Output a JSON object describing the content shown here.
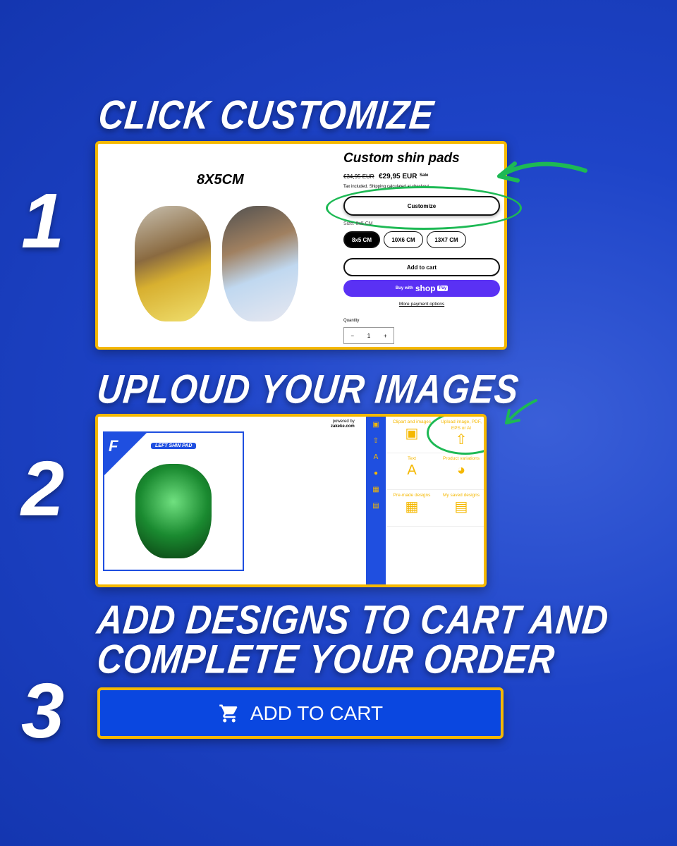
{
  "steps": [
    {
      "number": "1",
      "heading": "CLICK CUSTOMIZE"
    },
    {
      "number": "2",
      "heading": "UPLOUD YOUR IMAGES"
    },
    {
      "number": "3",
      "heading_line1": "ADD DESIGNS TO CART AND",
      "heading_line2": "COMPLETE YOUR ORDER"
    }
  ],
  "product": {
    "size_label": "8X5CM",
    "title": "Custom shin pads",
    "old_price": "€34,95 EUR",
    "price": "€29,95 EUR",
    "sale_badge": "Sale",
    "tax_note": "Tax included. Shipping calculated at checkout.",
    "customize": "Customize",
    "size_field": "Size: 8x5 CM",
    "sizes": [
      "8x5 CM",
      "10X6 CM",
      "13X7 CM"
    ],
    "selected_size": "8x5 CM",
    "add_to_cart": "Add to cart",
    "buy_with": "Buy with",
    "shop": "shop",
    "pay": "Pay",
    "more_payment": "More payment options",
    "quantity_label": "Quantity",
    "quantity": "1",
    "minus": "−",
    "plus": "+"
  },
  "designer": {
    "badge": "LEFT SHIN PAD",
    "powered_by": "powered by",
    "powered_brand": "zakeke.com",
    "tools": [
      {
        "label": "Clipart and images",
        "icon": "image-icon"
      },
      {
        "label": "Upload image, PDF, EPS or AI",
        "icon": "upload-icon"
      },
      {
        "label": "Text",
        "icon": "text-icon"
      },
      {
        "label": "Product variations",
        "icon": "palette-icon"
      },
      {
        "label": "Pre-made designs",
        "icon": "layout-icon"
      },
      {
        "label": "My saved designs",
        "icon": "folder-image-icon"
      }
    ]
  },
  "cart_button": {
    "label": "ADD TO CART",
    "icon": "cart-icon"
  },
  "colors": {
    "accent": "#f5b800",
    "brand_blue": "#0a47e0",
    "annotation_green": "#1db954",
    "shop_pay": "#5a31f4"
  }
}
